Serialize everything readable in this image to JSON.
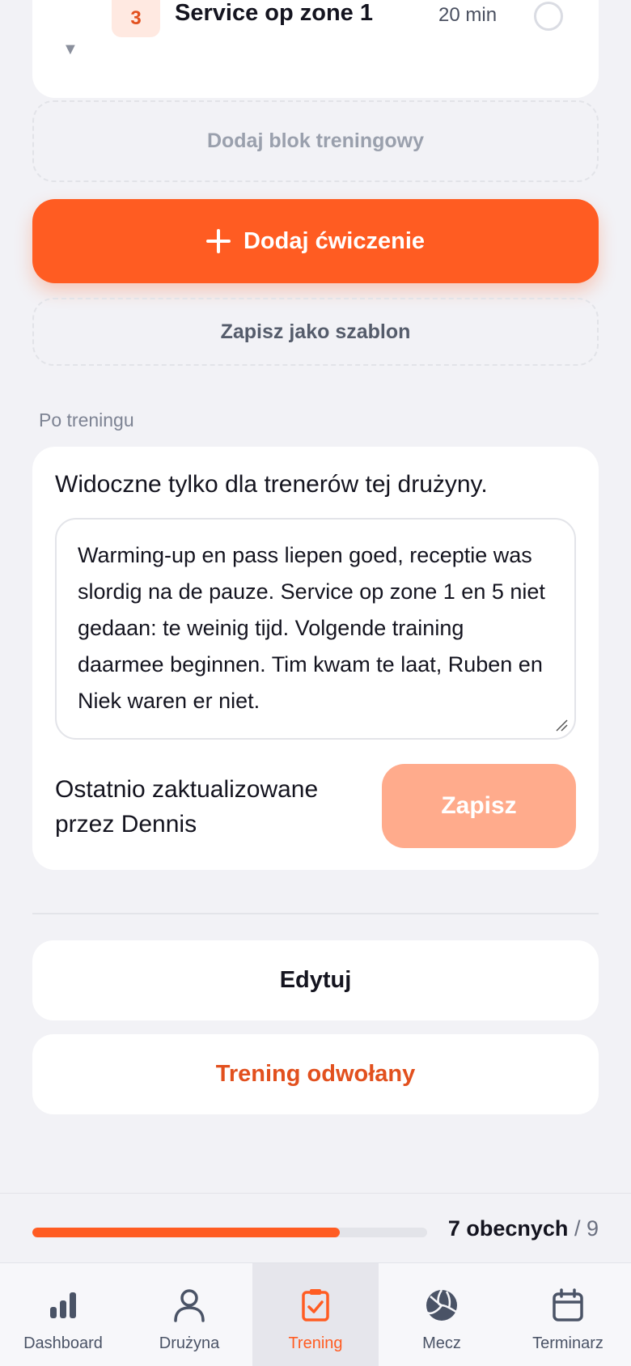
{
  "exercise": {
    "number": "3",
    "title": "Service op zone 1",
    "duration": "20 min",
    "caret": "▼"
  },
  "actions": {
    "add_block": "Dodaj blok treningowy",
    "add_exercise": "Dodaj ćwiczenie",
    "save_template": "Zapisz jako szablon"
  },
  "after_training": {
    "section_label": "Po treningu",
    "visibility_hint": "Widoczne tylko dla trenerów tej drużyny.",
    "notes": "Warming-up en pass liepen goed, receptie was slordig na de pauze. Service op zone 1 en 5 niet gedaan: te weinig tijd. Volgende training daarmee beginnen. Tim kwam te laat, Ruben en Niek waren er niet.",
    "last_updated": "Ostatnio zaktualizowane przez Dennis",
    "save_label": "Zapisz"
  },
  "edit_label": "Edytuj",
  "cancel_label": "Trening odwołany",
  "attendance": {
    "present_text": "7 obecnych",
    "separator": "/",
    "total": "9",
    "present": 7,
    "total_count": 9
  },
  "nav": {
    "items": [
      {
        "label": "Dashboard",
        "icon": "bar-chart-icon"
      },
      {
        "label": "Drużyna",
        "icon": "user-icon"
      },
      {
        "label": "Trening",
        "icon": "clipboard-check-icon",
        "active": true
      },
      {
        "label": "Mecz",
        "icon": "volleyball-icon"
      },
      {
        "label": "Terminarz",
        "icon": "calendar-icon"
      }
    ]
  },
  "colors": {
    "accent": "#ff5c22",
    "accent_light": "#ffab8c",
    "danger_text": "#e2501e",
    "background": "#f2f2f6"
  }
}
